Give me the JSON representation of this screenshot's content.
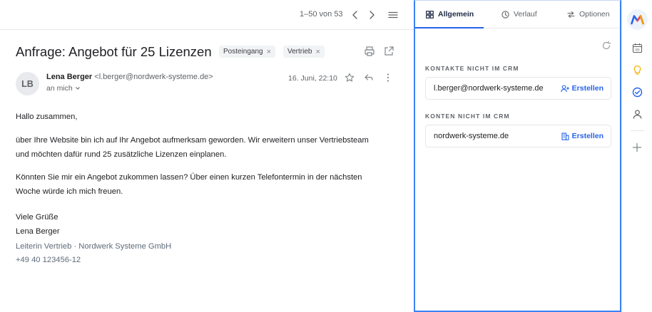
{
  "toolbar": {
    "pager": "1–50 von 53",
    "icons": [
      "chevron-left-icon",
      "chevron-right-icon",
      "menu-icon"
    ]
  },
  "email": {
    "subject": "Anfrage: Angebot für 25 Lizenzen",
    "labels": [
      {
        "text": "Posteingang"
      },
      {
        "text": "Vertrieb"
      }
    ],
    "sender_initials": "LB",
    "sender_name": "Lena Berger",
    "sender_address": "<l.berger@nordwerk-systeme.de>",
    "to_me": "an mich",
    "date": "16. Juni, 22:10",
    "body": {
      "greeting": "Hallo zusammen,",
      "p1_line1": "über Ihre Website bin ich auf Ihr Angebot aufmerksam geworden. Wir erweitern unser Vertriebsteam",
      "p1_line2": "und möchten dafür rund 25 zusätzliche Lizenzen einplanen.",
      "p2_line1": "Könnten Sie mir ein Angebot zukommen lassen? Über einen kurzen Telefontermin in der nächsten",
      "p2_line2": "Woche würde ich mich freuen.",
      "closing": "Viele Grüße",
      "sig_name": "Lena Berger",
      "sig_title": "Leiterin Vertrieb · Nordwerk Systeme GmbH",
      "sig_phone": "+49 40 123456-12"
    }
  },
  "crm": {
    "tabs": [
      {
        "label": "Allgemein",
        "icon": "grid-icon",
        "active": true
      },
      {
        "label": "Verlauf",
        "icon": "clock-icon",
        "active": false
      },
      {
        "label": "Optionen",
        "icon": "sliders-icon",
        "active": false
      }
    ],
    "contacts_title": "KONTAKTE NICHT IM CRM",
    "contact": {
      "value": "l.berger@nordwerk-systeme.de",
      "action": "Erstellen"
    },
    "accounts_title": "KONTEN NICHT IM CRM",
    "account": {
      "value": "nordwerk-systeme.de",
      "action": "Erstellen"
    }
  },
  "colors": {
    "accent": "#2563eb",
    "panel_border": "#3b82f6"
  }
}
